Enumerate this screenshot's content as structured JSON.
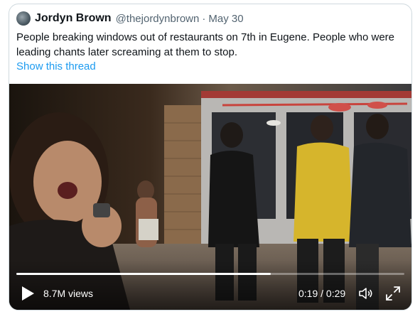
{
  "tweet": {
    "author_name": "Jordyn Brown",
    "handle": "@thejordynbrown",
    "separator": "·",
    "date": "May 30",
    "text": "People breaking windows out of restaurants on 7th in Eugene. People who were leading chants later screaming at them to stop.",
    "thread_link": "Show this thread"
  },
  "video": {
    "views": "8.7M views",
    "time": "0:19 / 0:29",
    "progress_fraction": 0.655,
    "icons": {
      "play": "play-icon",
      "volume": "volume-icon",
      "fullscreen": "fullscreen-icon"
    }
  },
  "colors": {
    "link": "#1d9bf0",
    "text_primary": "#0f1419",
    "text_secondary": "#536471",
    "border": "#cfd9de"
  }
}
